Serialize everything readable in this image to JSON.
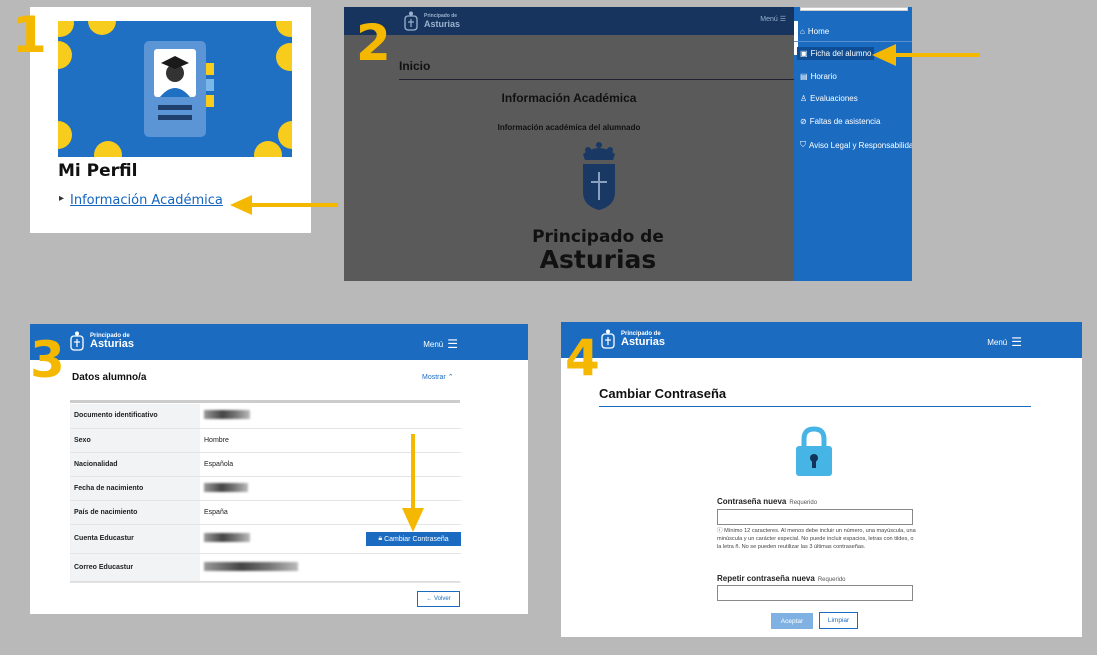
{
  "steps": [
    "1",
    "2",
    "3",
    "4"
  ],
  "accent": "#f5b800",
  "brand_blue": "#1b6cc1",
  "panel1": {
    "title": "Mi Perfil",
    "link": "Información Académica"
  },
  "panel2": {
    "logo_line1": "Principado de",
    "logo_line2": "Asturias",
    "menu_label": "Menú",
    "inicio": "Inicio",
    "heading": "Información Académica",
    "subheading": "Información académica del alumnado",
    "brand_line1": "Principado de",
    "brand_line2": "Asturias",
    "menu_items": [
      {
        "label": "Home",
        "icon": "home-icon"
      },
      {
        "label": "Ficha del alumno",
        "icon": "id-card-icon"
      },
      {
        "label": "Horario",
        "icon": "calendar-icon"
      },
      {
        "label": "Evaluaciones",
        "icon": "people-icon"
      },
      {
        "label": "Faltas de asistencia",
        "icon": "absence-icon"
      },
      {
        "label": "Aviso Legal y Responsabilidad",
        "icon": "shield-icon"
      }
    ]
  },
  "panel3": {
    "logo_line1": "Principado de",
    "logo_line2": "Asturias",
    "menu_label": "Menú",
    "section_title": "Datos alumno/a",
    "toggle": "Mostrar",
    "rows": [
      {
        "key": "Documento identificativo",
        "value": ""
      },
      {
        "key": "Sexo",
        "value": "Hombre"
      },
      {
        "key": "Nacionalidad",
        "value": "Española"
      },
      {
        "key": "Fecha de nacimiento",
        "value": ""
      },
      {
        "key": "País de nacimiento",
        "value": "España"
      },
      {
        "key": "Cuenta Educastur",
        "value": ""
      },
      {
        "key": "Correo Educastur",
        "value": ""
      }
    ],
    "change_password_button": "Cambiar Contraseña",
    "back_button": "← Volver"
  },
  "panel4": {
    "logo_line1": "Principado de",
    "logo_line2": "Asturias",
    "menu_label": "Menú",
    "title": "Cambiar Contraseña",
    "new_password_label": "Contraseña nueva",
    "required": "Requerido",
    "new_password_value": "",
    "hint": "Mínimo 12 caracteres. Al menos debe incluir un número, una mayúscula, una minúscula y un carácter especial. No puede incluir espacios, letras con tildes, o la letra ñ. No se pueden reutilizar las 3 últimas contraseñas.",
    "repeat_password_label": "Repetir contraseña nueva",
    "repeat_password_value": "",
    "accept_button": "Aceptar",
    "clear_button": "Limpiar"
  }
}
